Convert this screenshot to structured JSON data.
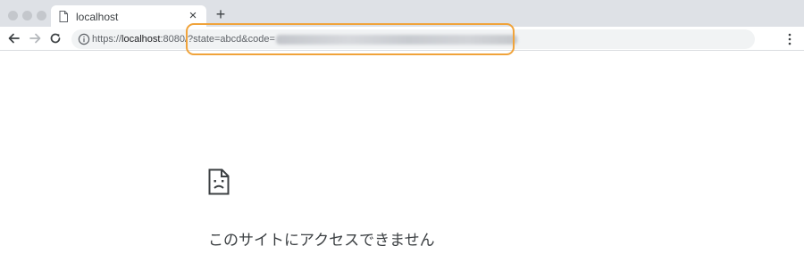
{
  "tab": {
    "title": "localhost"
  },
  "address_bar": {
    "scheme": "https://",
    "host": "localhost",
    "port_and_query": ":8080/?state=abcd&code="
  },
  "error_page": {
    "title": "このサイトにアクセスできません"
  },
  "colors": {
    "highlight": "#f0a33a",
    "tabstrip": "#dee1e6",
    "omnibox": "#f1f3f4"
  },
  "icons": {
    "tab_favicon": "page-icon",
    "back": "arrow-left-icon",
    "forward": "arrow-right-icon",
    "reload": "reload-icon",
    "info": "info-icon",
    "bookmark": "star-icon",
    "menu": "kebab-menu-icon",
    "error": "sad-page-icon"
  }
}
